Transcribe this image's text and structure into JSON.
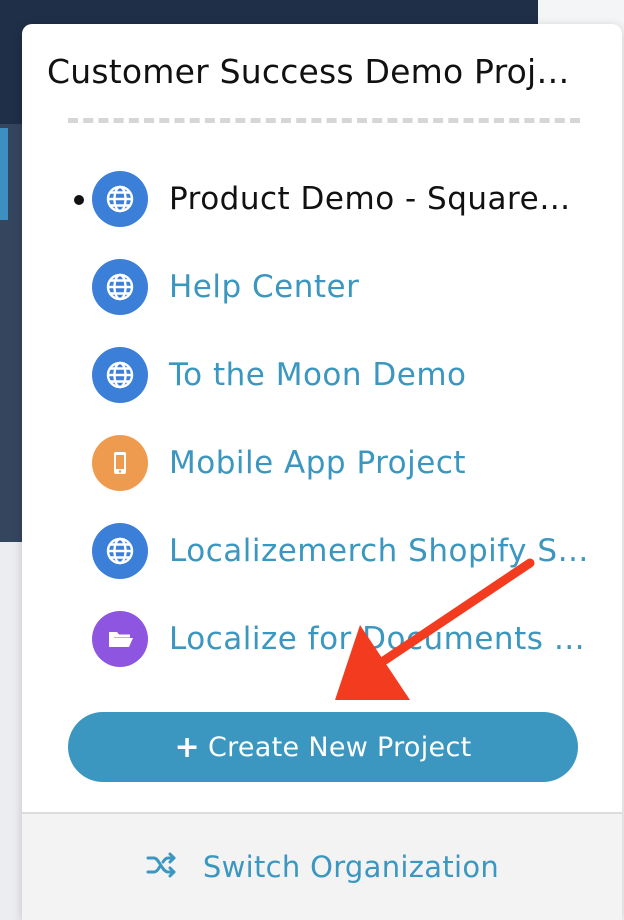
{
  "organization": {
    "title": "Customer Success Demo Proj…"
  },
  "projects": [
    {
      "label": "Product Demo - Square…",
      "icon": "globe-icon",
      "icon_color": "#3b7fd9",
      "active": true
    },
    {
      "label": "Help Center",
      "icon": "globe-icon",
      "icon_color": "#3b7fd9",
      "active": false
    },
    {
      "label": "To the Moon Demo",
      "icon": "globe-icon",
      "icon_color": "#3b7fd9",
      "active": false
    },
    {
      "label": "Mobile App Project",
      "icon": "mobile-phone-icon",
      "icon_color": "#ef9b4f",
      "active": false
    },
    {
      "label": "Localizemerch Shopify S…",
      "icon": "globe-icon",
      "icon_color": "#3b7fd9",
      "active": false
    },
    {
      "label": "Localize for Documents …",
      "icon": "open-folder-icon",
      "icon_color": "#8e55e0",
      "active": false
    }
  ],
  "create_button": {
    "label": "Create New Project",
    "icon": "plus-icon"
  },
  "footer": {
    "label": "Switch Organization",
    "icon": "shuffle-icon"
  },
  "colors": {
    "accent": "#3b97c0",
    "active_text": "#111111",
    "link_text": "#3b97c0",
    "annotation_arrow": "#f23b1f"
  }
}
